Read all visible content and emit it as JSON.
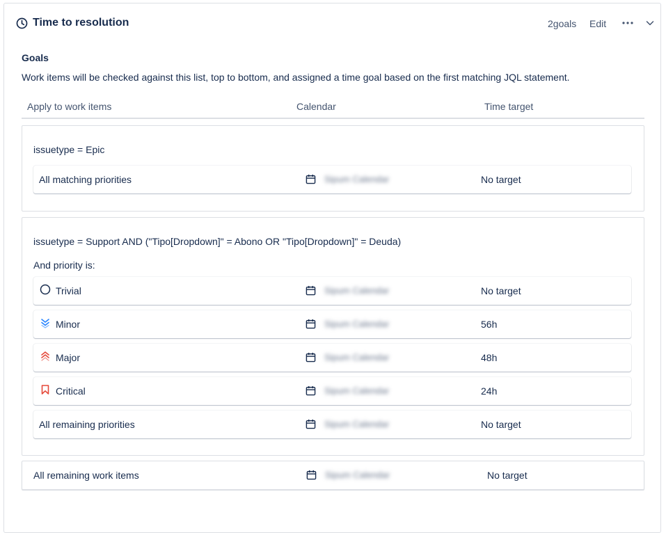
{
  "header": {
    "title": "Time to resolution",
    "goals_count": "2goals",
    "edit_label": "Edit"
  },
  "goals": {
    "heading": "Goals",
    "description": "Work items will be checked against this list, top to bottom, and assigned a time goal based on the first matching JQL statement.",
    "columns": {
      "apply": "Apply to work items",
      "calendar": "Calendar",
      "time_target": "Time target"
    }
  },
  "groups": [
    {
      "jql": "issuetype = Epic",
      "rows": [
        {
          "label": "All matching priorities",
          "calendar": "Sipum Calendar",
          "target": "No target"
        }
      ]
    },
    {
      "jql": "issuetype = Support AND (\"Tipo[Dropdown]\" = Abono OR \"Tipo[Dropdown]\" = Deuda)",
      "and_priority_label": "And priority is:",
      "rows": [
        {
          "label": "Trivial",
          "icon": "circle-outline-icon",
          "calendar": "Sipum Calendar",
          "target": "No target"
        },
        {
          "label": "Minor",
          "icon": "double-chevron-down-icon",
          "icon_color": "#2684ff",
          "calendar": "Sipum Calendar",
          "target": "56h"
        },
        {
          "label": "Major",
          "icon": "double-chevron-up-icon",
          "icon_color": "#e5493a",
          "calendar": "Sipum Calendar",
          "target": "48h"
        },
        {
          "label": "Critical",
          "icon": "bookmark-flag-icon",
          "icon_color": "#e5493a",
          "calendar": "Sipum Calendar",
          "target": "24h"
        },
        {
          "label": "All remaining priorities",
          "calendar": "Sipum Calendar",
          "target": "No target"
        }
      ]
    }
  ],
  "remaining": {
    "label": "All remaining work items",
    "calendar": "Sipum Calendar",
    "target": "No target"
  },
  "colors": {
    "minor": "#2684ff",
    "major": "#e5493a",
    "critical": "#e5493a",
    "border": "#dcdfe4",
    "text": "#172b4d"
  }
}
